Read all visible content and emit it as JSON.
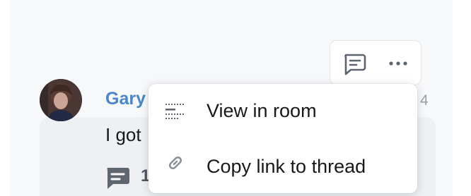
{
  "message": {
    "sender": "Gary",
    "body": "I got",
    "timestamp_partial": "4",
    "thread_reply_count": "1"
  },
  "context_menu": {
    "items": [
      {
        "label": "View in room",
        "icon": "view-in-room-icon"
      },
      {
        "label": "Copy link to thread",
        "icon": "link-icon"
      }
    ]
  },
  "action_bar": {
    "buttons": [
      {
        "icon": "thread-icon"
      },
      {
        "icon": "more-options-icon"
      }
    ]
  },
  "colors": {
    "sender": "#4a86c8",
    "panel_background": "#f7f8fa",
    "bubble_background": "#eef0f3",
    "menu_text": "#17191c",
    "icon_gray": "#5c6470"
  }
}
